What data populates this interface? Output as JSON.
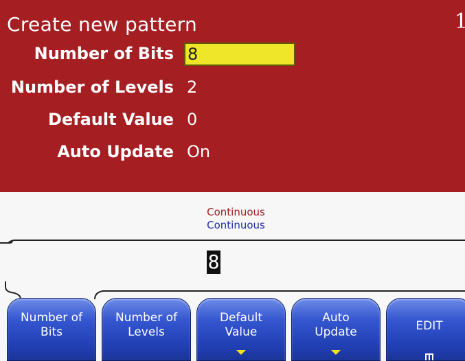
{
  "panel": {
    "title": "Create new pattern",
    "channel": "1",
    "fields": {
      "bits": {
        "label": "Number of Bits",
        "value": "8"
      },
      "levels": {
        "label": "Number of Levels",
        "value": "2"
      },
      "default": {
        "label": "Default Value",
        "value": "0"
      },
      "auto": {
        "label": "Auto Update",
        "value": "On"
      }
    }
  },
  "display": {
    "mode_line1": "Continuous",
    "mode_line2": "Continuous",
    "entry_value": "8"
  },
  "softkeys": [
    {
      "line1": "Number of",
      "line2": "Bits"
    },
    {
      "line1": "Number of",
      "line2": "Levels"
    },
    {
      "line1": "Default",
      "line2": "Value",
      "arrow": true
    },
    {
      "line1": "Auto",
      "line2": "Update",
      "arrow": true
    },
    {
      "line1": "EDIT",
      "line2": "",
      "icon": "grid-icon"
    }
  ],
  "colors": {
    "panel_bg": "#a51e22",
    "field_highlight": "#efe62a",
    "softkey_blue": "#2240b6",
    "mode1_text": "#a01f22",
    "mode2_text": "#1f2fa8",
    "arrow_yellow": "#f2e21a"
  }
}
